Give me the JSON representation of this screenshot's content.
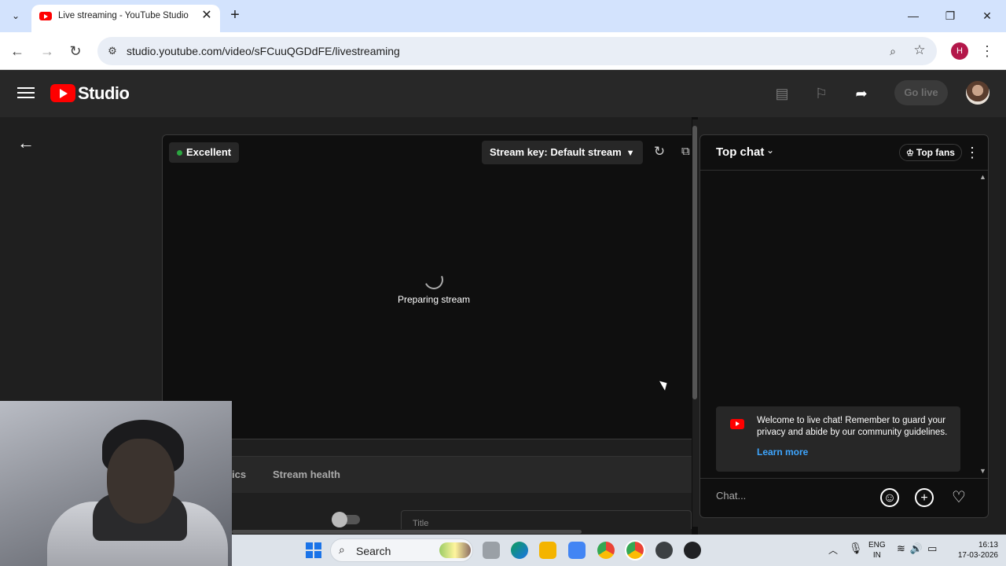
{
  "browser": {
    "tab_title": "Live streaming - YouTube Studio",
    "tab_close": "✕",
    "new_tab": "+",
    "url": "studio.youtube.com/video/sFCuuQGDdFE/livestreaming",
    "profile_initial": "H",
    "icons": [
      "tab-search-icon",
      "minimize-icon",
      "restore-icon",
      "close-icon",
      "back-icon",
      "forward-icon",
      "reload-icon",
      "site-info-icon",
      "zoom-icon",
      "star-icon",
      "more-vert-icon"
    ]
  },
  "studio": {
    "wordmark": "Studio",
    "go_live_label": "Go live",
    "brand_color": "#ff0000"
  },
  "preview": {
    "quality": "Excellent",
    "quality_color": "#2ba640",
    "stream_key": "Stream key: Default stream",
    "status": "Preparing stream"
  },
  "bottom_tabs": {
    "analytics_partial": "ics",
    "health": "Stream health",
    "title_label": "Title"
  },
  "chat": {
    "mode": "Top chat",
    "top_fans": "Top fans",
    "welcome": "Welcome to live chat! Remember to guard your privacy and abide by our community guidelines.",
    "learn_more": "Learn more",
    "input_placeholder": "Chat...",
    "link_color": "#3ea6ff"
  },
  "taskbar": {
    "search_label": "Search",
    "lang_line1": "ENG",
    "lang_line2": "IN",
    "time": "16:13",
    "date": "17-03-2026"
  }
}
